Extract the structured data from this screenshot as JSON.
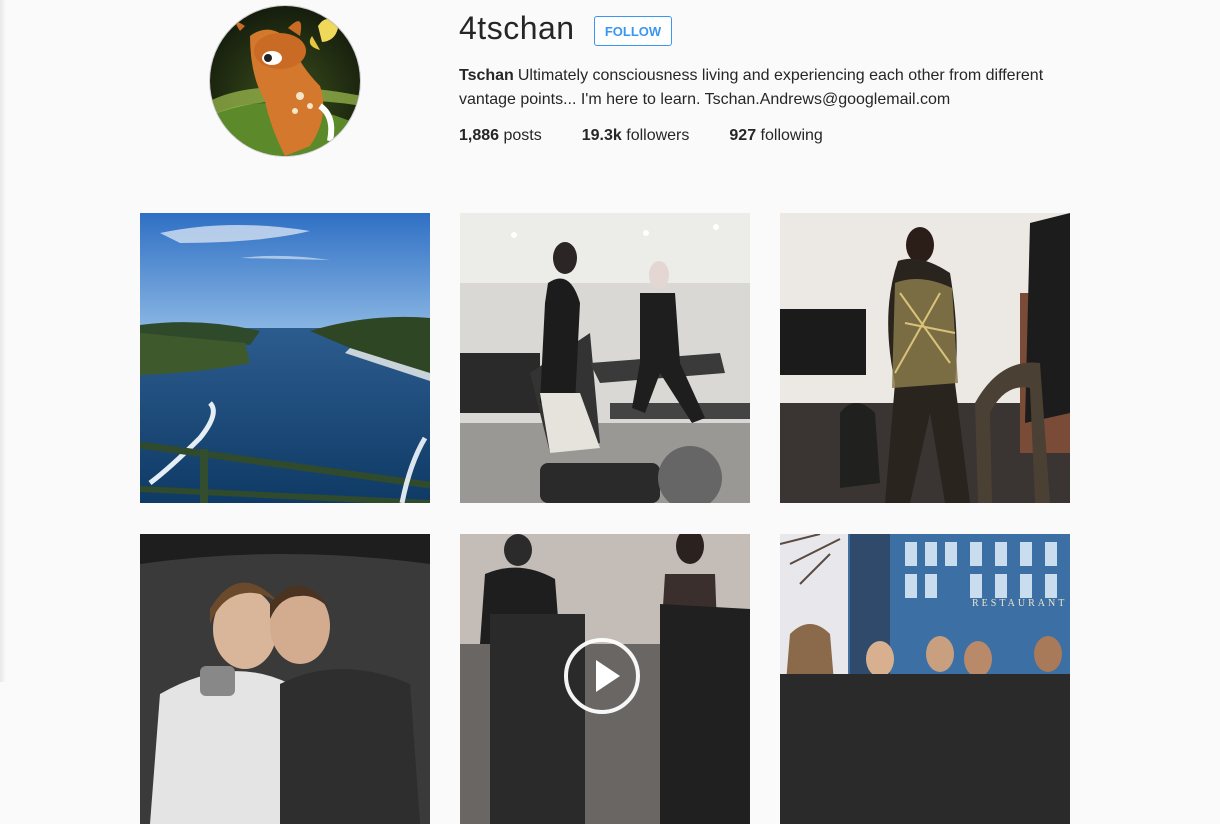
{
  "profile": {
    "username": "4tschan",
    "follow_label": "FOLLOW",
    "full_name": "Tschan",
    "bio": "Ultimately consciousness living and experiencing each other from different vantage points... I'm here to learn. Tschan.Andrews@googlemail.com",
    "stats": {
      "posts_count": "1,886",
      "posts_label": "posts",
      "followers_count": "19.3k",
      "followers_label": "followers",
      "following_count": "927",
      "following_label": "following"
    }
  },
  "accent_color": "#3897f0",
  "posts": [
    {
      "subject": "lake view",
      "is_video": false
    },
    {
      "subject": "gym treadmills",
      "is_video": false
    },
    {
      "subject": "model posing",
      "is_video": false
    },
    {
      "subject": "two friends selfie",
      "is_video": false
    },
    {
      "subject": "gym video",
      "is_video": true
    },
    {
      "subject": "street group",
      "is_video": false,
      "sign_text": "RESTAURANT"
    }
  ]
}
